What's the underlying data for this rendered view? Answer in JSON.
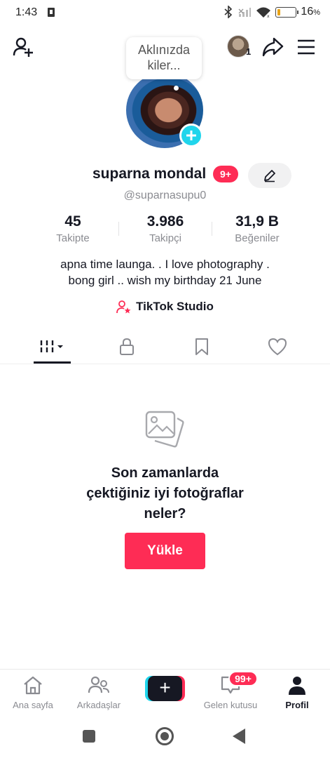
{
  "status_bar": {
    "time": "1:43",
    "battery_percent": "16",
    "battery_unit": "%",
    "battery_level": 0.16,
    "icons": [
      "sim-card-icon",
      "bluetooth-icon",
      "signal-icon",
      "wifi-icon",
      "battery-icon"
    ]
  },
  "header": {
    "add_friend_icon": "add-user-icon",
    "account_count": "1",
    "share_icon": "share-icon",
    "menu_icon": "menu-icon"
  },
  "profile": {
    "note_bubble": "Aklınızda kiler...",
    "name": "suparna mondal",
    "notification_badge": "9+",
    "handle": "@suparnasupu0",
    "stats": [
      {
        "value": "45",
        "label": "Takipte"
      },
      {
        "value": "3.986",
        "label": "Takipçi"
      },
      {
        "value": "31,9 B",
        "label": "Beğeniler"
      }
    ],
    "bio_line1": "apna time launga. . I love photography .",
    "bio_line2": "bong girl .. wish my birthday 21 June",
    "studio_link": "TikTok Studio"
  },
  "tabs": [
    {
      "icon": "videos-grid-icon",
      "active": true
    },
    {
      "icon": "lock-icon",
      "active": false
    },
    {
      "icon": "bookmark-icon",
      "active": false
    },
    {
      "icon": "heart-icon",
      "active": false
    }
  ],
  "empty_state": {
    "icon": "photos-icon",
    "line1": "Son zamanlarda",
    "line2": "çektiğiniz iyi fotoğraflar",
    "line3": "neler?",
    "button": "Yükle"
  },
  "bottom_nav": {
    "home": "Ana sayfa",
    "friends": "Arkadaşlar",
    "create": "+",
    "inbox": "Gelen kutusu",
    "inbox_badge": "99+",
    "profile": "Profil"
  },
  "colors": {
    "accent": "#fe2c55",
    "cyan": "#20d5ec",
    "text": "#161823",
    "muted": "#8a8b91"
  }
}
